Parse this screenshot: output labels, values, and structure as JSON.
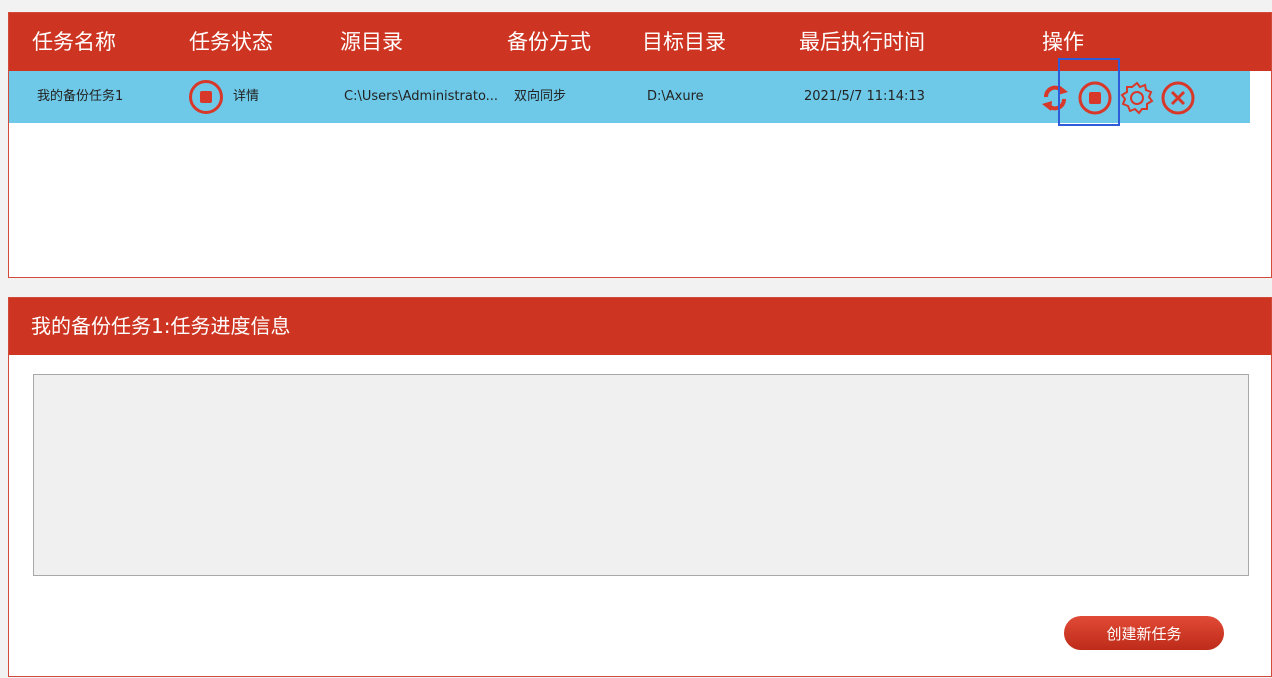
{
  "table": {
    "headers": {
      "name": "任务名称",
      "status": "任务状态",
      "source": "源目录",
      "mode": "备份方式",
      "target": "目标目录",
      "last_run": "最后执行时间",
      "actions": "操作"
    },
    "rows": [
      {
        "name": "我的备份任务1",
        "status_link": "详情",
        "source": "C:\\Users\\Administrato...",
        "mode": "双向同步",
        "target": "D:\\Axure",
        "last_run": "2021/5/7 11:14:13"
      }
    ]
  },
  "icons": {
    "status": "stop-circle-icon",
    "actions": [
      "sync-icon",
      "stop-circle-icon",
      "gear-icon",
      "close-circle-icon"
    ]
  },
  "progress": {
    "title": "我的备份任务1:任务进度信息"
  },
  "buttons": {
    "create": "创建新任务"
  },
  "colors": {
    "header_red": "#cd3522",
    "row_selected": "#6ec9e8",
    "icon_red": "#d7382a",
    "highlight_blue": "#2e5bd8"
  }
}
